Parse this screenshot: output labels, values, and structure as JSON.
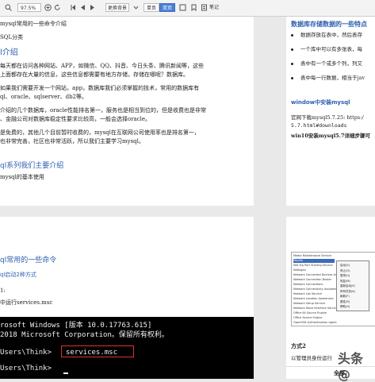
{
  "toolbar": {
    "zoom": "97.5%",
    "bg_label": "更换背景",
    "seg1": "单页",
    "seg2": "双页",
    "notes_label": "笔记"
  },
  "page_tl": {
    "line1": "mysql常用的一些命令介绍",
    "line2": "SQL分类",
    "h1": "l介绍",
    "p1a": "每天都在访问各种网站、APP，如微信、QQ、抖音、今日头条、腾讯新闻等，这些",
    "p1b": "上面都存在大量的信息，这些信息都需要有地方存储，存储在哪呢？数据库。",
    "p2a": "如果我们需要开发一个网站，app，数据库我们必须掌握的技术，常用的数据库有",
    "p2b": "ql、oracle、sqlserver、db2等。",
    "p3a": "介绍的几个数据库，oracle性能排名第一，服务也是相当到位的，但是收费也是非常",
    "p3b": "、金融公司对数据库稳定性要求比较高，一般会选择oracle。",
    "p4a": "是免费的，其他几个目前暂时收费的，mysql在互联网公司使用率也是排名第一，",
    "p4b": "也非常完善，社区也非常活跃，所以我们主要学习mysql。",
    "h2": "ql系列我们主要介绍",
    "line_end": "mysql的基本使用"
  },
  "page_tr": {
    "h1": "数据库存储数据的一些特点",
    "b1": "数据存放在表中，然后表存",
    "b2": "一个库中可以有多张表，每",
    "b3": "表中有一个或多个列，列又",
    "b4": "表中每一行数据，相当于jav",
    "h2": "window中安装mysql",
    "t1": "官网下载mysql5.7.25: https:/",
    "t2": "5.7.html#downloads",
    "t3": "win10安装mysql5.7详细步骤可"
  },
  "page_bl": {
    "h1": "ql常用的一些命令",
    "h2": "ql启动2种方式",
    "t1": "1:",
    "t2": "中运行services.msc",
    "cmd1": "rosoft Windows [版本 10.0.17763.615]",
    "cmd2": " 2018 Microsoft Corporation。保留所有权利。",
    "cmd3": "Users\\Think>",
    "cmd3b": "services.msc",
    "cmd4": "Users\\Think>"
  },
  "page_br": {
    "shot_rows": [
      "Media Maintenance Service",
      "Mozilla",
      "Net.Tcp Port Sharing Service",
      "Netlogon",
      "Network Connected Devices Auto-Setup",
      "Network Connection Broker",
      "Network Connections",
      "Network Connectivity Assistant",
      "Network List Service",
      "Network Location Awareness",
      "Network Setup Service",
      "Network Store Interface Service",
      "Office 64 Source Engine",
      "Office Source Engine",
      "OpenSSH Authentication Agent"
    ],
    "menu_items": [
      "启动(S)",
      "停止(O)",
      "暂停(U)",
      "恢复(M)",
      "重新启动(E)",
      "所有任务(K)",
      "刷新(F)",
      "属性(R)",
      "帮助(H)"
    ],
    "h1": "方式2",
    "t1": "以管理员身份运行",
    "tab": "全部"
  },
  "watermark": "头条 @"
}
